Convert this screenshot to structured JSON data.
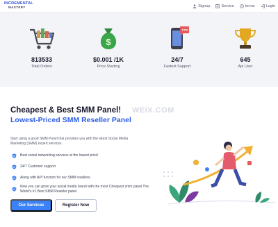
{
  "brand": {
    "logo_line1": "INCREMENTAL",
    "logo_line2": "MASTERY"
  },
  "nav": {
    "signup": "Signup",
    "service": "Service",
    "terms": "terms",
    "login": "Login"
  },
  "stats": [
    {
      "icon": "cart-icon",
      "value": "813533",
      "label": "Total Orders"
    },
    {
      "icon": "money-bag-icon",
      "value": "$0.001 /1K",
      "label": "Price Starting"
    },
    {
      "icon": "phone-support-icon",
      "value": "24/7",
      "label": "Fastest Support"
    },
    {
      "icon": "trophy-icon",
      "value": "645",
      "label": "Api User"
    }
  ],
  "hero": {
    "title": "Cheapest & Best SMM Panel!",
    "subtitle": "Lowest-Priced SMM Reseller Panel",
    "watermark": "WEIX.COM",
    "description": "Start using a good SMM Panel that provides you with the latest Social Media Marketing (SMM) expert services.",
    "features": [
      "Best social networking services at the lowest price!",
      "24/7 Customer support.",
      "Along with API function for our SMM resellers.",
      "Now you can grow your social media brand with the most Cheapest smm panel The World's #1 Best SMM Reseller panel."
    ],
    "primary_button": "Our Services",
    "secondary_button": "Register Now"
  },
  "colors": {
    "accent": "#3b82f6",
    "subtitle_blue": "#2e5ee8",
    "stats_background": "#f3f4f7"
  }
}
